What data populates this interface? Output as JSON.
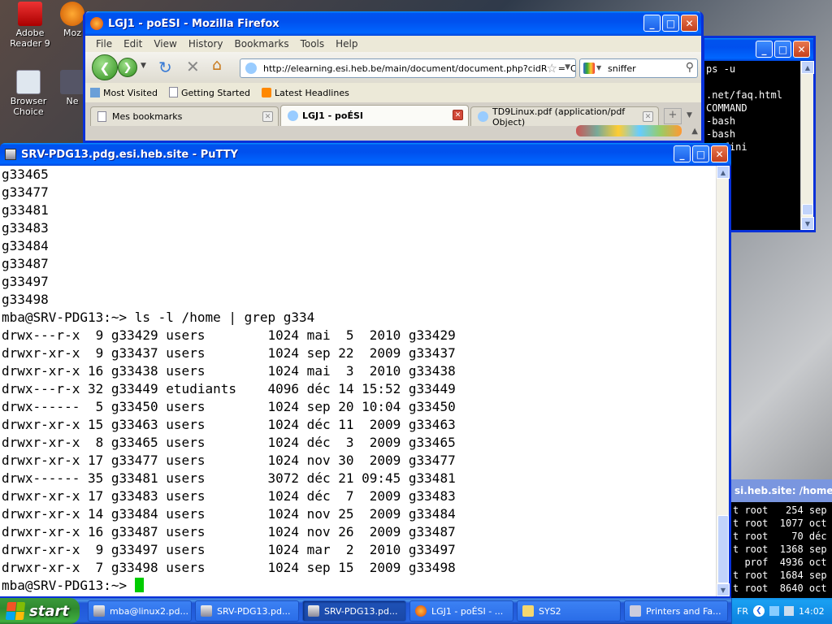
{
  "desktop": {
    "icons": [
      {
        "label": "Adobe Reader 9"
      },
      {
        "label": "Moz"
      },
      {
        "label": "Browser Choice"
      },
      {
        "label": "Ne"
      }
    ]
  },
  "firefox": {
    "title": "LGJ1 - poÉSI - Mozilla Firefox",
    "menu": [
      "File",
      "Edit",
      "View",
      "History",
      "Bookmarks",
      "Tools",
      "Help"
    ],
    "url": "http://elearning.esi.heb.be/main/document/document.php?cidReq=LC",
    "search_value": "sniffer",
    "bookmarks": [
      "Most Visited",
      "Getting Started",
      "Latest Headlines"
    ],
    "tabs": [
      {
        "label": "Mes bookmarks"
      },
      {
        "label": "LGJ1 - poÉSI"
      },
      {
        "label": "TD9Linux.pdf (application/pdf Object)"
      }
    ]
  },
  "right_terminal": {
    "lines": [
      "ps -u",
      "",
      ".net/faq.html",
      "COMMAND",
      "-bash",
      "-bash",
      " Infini"
    ]
  },
  "bottom_right_terminal": {
    "title": "si.heb.site: /home/m",
    "lines": [
      "t root   254 sep",
      "t root  1077 oct",
      "t root    70 déc",
      "t root  1368 sep",
      "  prof  4936 oct",
      "t root  1684 sep",
      "t root  8640 oct",
      "t"
    ]
  },
  "putty": {
    "title": "SRV-PDG13.pdg.esi.heb.site - PuTTY",
    "lines": [
      "g33465",
      "g33477",
      "g33481",
      "g33483",
      "g33484",
      "g33487",
      "g33497",
      "g33498",
      "mba@SRV-PDG13:~> ls -l /home | grep g334",
      "drwx---r-x  9 g33429 users        1024 mai  5  2010 g33429",
      "drwxr-xr-x  9 g33437 users        1024 sep 22  2009 g33437",
      "drwxr-xr-x 16 g33438 users        1024 mai  3  2010 g33438",
      "drwx---r-x 32 g33449 etudiants    4096 déc 14 15:52 g33449",
      "drwx------  5 g33450 users        1024 sep 20 10:04 g33450",
      "drwxr-xr-x 15 g33463 users        1024 déc 11  2009 g33463",
      "drwxr-xr-x  8 g33465 users        1024 déc  3  2009 g33465",
      "drwxr-xr-x 17 g33477 users        1024 nov 30  2009 g33477",
      "drwx------ 35 g33481 users        3072 déc 21 09:45 g33481",
      "drwxr-xr-x 17 g33483 users        1024 déc  7  2009 g33483",
      "drwxr-xr-x 14 g33484 users        1024 nov 25  2009 g33484",
      "drwxr-xr-x 16 g33487 users        1024 nov 26  2009 g33487",
      "drwxr-xr-x  9 g33497 users        1024 mar  2  2010 g33497",
      "drwxr-xr-x  7 g33498 users        1024 sep 15  2009 g33498"
    ],
    "prompt": "mba@SRV-PDG13:~> "
  },
  "taskbar": {
    "start_label": "start",
    "items": [
      {
        "label": "mba@linux2.pd..."
      },
      {
        "label": "SRV-PDG13.pd..."
      },
      {
        "label": "SRV-PDG13.pd..."
      },
      {
        "label": "LGJ1 - poÉSI - ..."
      },
      {
        "label": "SYS2"
      },
      {
        "label": "Printers and Fa..."
      }
    ],
    "language": "FR",
    "clock": "14:02"
  },
  "colors": {
    "xp_blue": "#0054e3",
    "start_green": "#3c9a3c",
    "cursor_green": "#00cc00"
  }
}
